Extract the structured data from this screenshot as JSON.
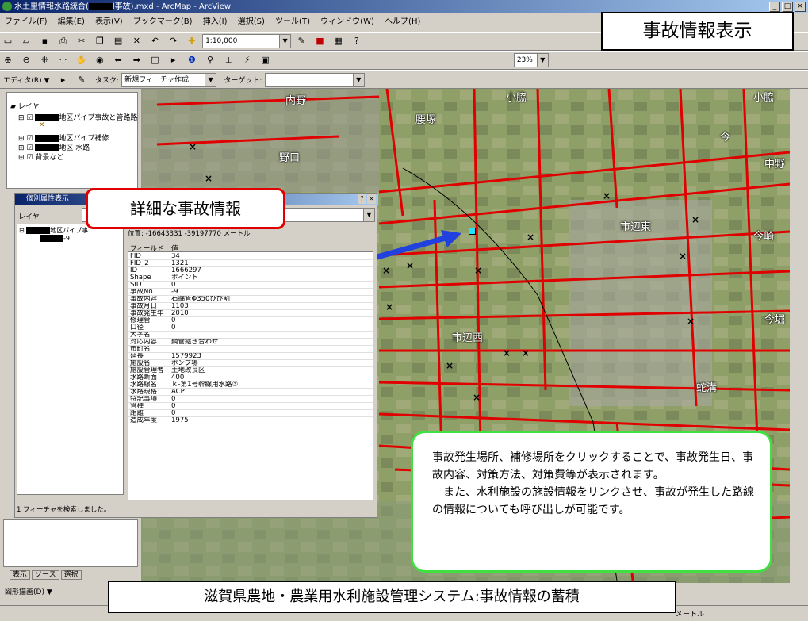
{
  "window": {
    "title_prefix": "水土里情報水路統合(",
    "title_suffix": "l事故).mxd - ArcMap - ArcView",
    "minimize": "_",
    "maximize": "□",
    "close": "×"
  },
  "menu": [
    "ファイル(F)",
    "編集(E)",
    "表示(V)",
    "ブックマーク(B)",
    "挿入(I)",
    "選択(S)",
    "ツール(T)",
    "ウィンドウ(W)",
    "ヘルプ(H)"
  ],
  "toolbar": {
    "scale_value": "1:10,000",
    "zoom_pct": "23%",
    "editor_label": "エディタ(R) ▼",
    "task_label": "タスク:",
    "task_value": "新規フィーチャ作成",
    "target_label": "ターゲット:"
  },
  "toc": {
    "root": "レイヤ",
    "layers": [
      "地区パイプ事故と管路路",
      "地区パイプ補修",
      "地区 水路",
      "背景など"
    ]
  },
  "identify": {
    "title": "個別属性表示",
    "layer_label": "レイヤ",
    "tree_item": "地区パイプ事",
    "tree_sub": "-9",
    "location_label": "位置:",
    "location_value": "-16643331 -39197770 メートル",
    "col_field": "フィールド",
    "col_value": "値",
    "rows": [
      [
        "FID",
        "34"
      ],
      [
        "FID_2",
        "1321"
      ],
      [
        "ID",
        "1666297"
      ],
      [
        "Shape",
        "ポイント"
      ],
      [
        "SID",
        "0"
      ],
      [
        "事故No",
        "-9"
      ],
      [
        "事故内容",
        "石綿管Φ350ひび割"
      ],
      [
        "事故月日",
        "1103"
      ],
      [
        "事故発生年",
        "2010"
      ],
      [
        "修理管",
        "0"
      ],
      [
        "口径",
        "0"
      ],
      [
        "大字名",
        ""
      ],
      [
        "対応内容",
        "鋼管継ぎ合わせ"
      ],
      [
        "市町名",
        ""
      ],
      [
        "延長",
        "1579923"
      ],
      [
        "施設名",
        "ポンプ場"
      ],
      [
        "施設管理者",
        "土地改良区"
      ],
      [
        "水路断面",
        "400"
      ],
      [
        "水路線名",
        "ｋ-第1号幹線用水路③"
      ],
      [
        "水路規格",
        "ACP"
      ],
      [
        "特記事項",
        "0"
      ],
      [
        "管種",
        "0"
      ],
      [
        "距離",
        "0"
      ],
      [
        "造成年度",
        "1975"
      ]
    ],
    "status": "1 フィーチャを検索しました。"
  },
  "callouts": {
    "title": "事故情報表示",
    "detail": "詳細な事故情報",
    "description_1": "事故発生場所、補修場所をクリックすることで、事故発生日、事故内容、対策方法、対策費等が表示されます。",
    "description_2": "また、水利施設の施設情報をリンクさせ、事故が発生した路線の情報についても呼び出しが可能です。",
    "caption": "滋賀県農地・農業用水利施設管理システム:事故情報の蓄積"
  },
  "map_labels": [
    "内野",
    "小脇",
    "小脇",
    "今",
    "中野",
    "野口",
    "市辺東",
    "今崎",
    "市辺西",
    "蛇溝",
    "今堀",
    "腰塚"
  ],
  "tabs": [
    "表示",
    "ソース",
    "選択"
  ],
  "drawing": "図形描画(D) ▼",
  "status_unit": "メートル",
  "colors": {
    "canal_red": "#e00000",
    "title_blue": "#0a246a",
    "callout_green": "#40e040",
    "arrow_blue": "#2040e0"
  }
}
